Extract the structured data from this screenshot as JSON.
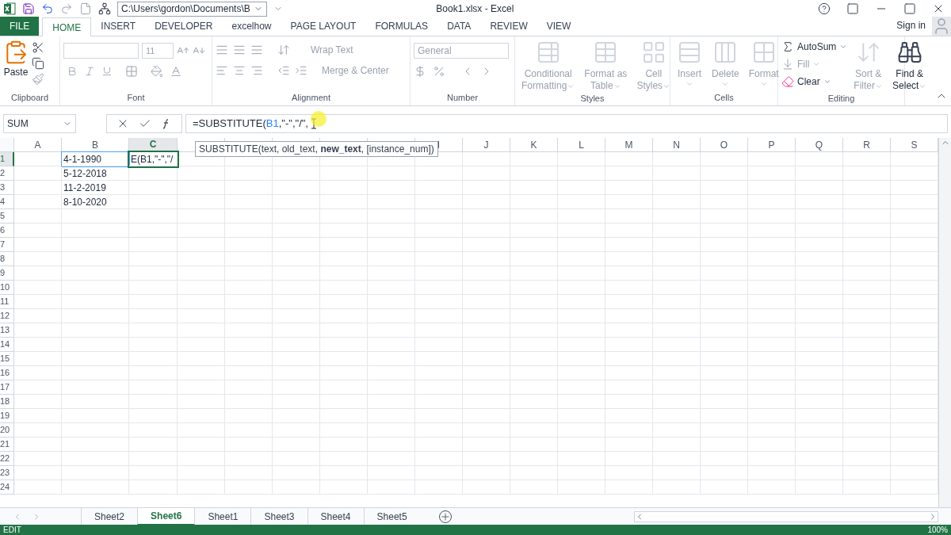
{
  "title_bar": {
    "path": "C:\\Users\\gordon\\Documents\\B",
    "title": "Book1.xlsx - Excel"
  },
  "ribbon_tabs": [
    {
      "label": "FILE",
      "kind": "file",
      "selected": false
    },
    {
      "label": "HOME",
      "kind": "tab",
      "selected": true
    },
    {
      "label": "INSERT",
      "kind": "tab",
      "selected": false
    },
    {
      "label": "DEVELOPER",
      "kind": "tab",
      "selected": false
    },
    {
      "label": "excelhow",
      "kind": "tab",
      "selected": false
    },
    {
      "label": "PAGE LAYOUT",
      "kind": "tab",
      "selected": false
    },
    {
      "label": "FORMULAS",
      "kind": "tab",
      "selected": false
    },
    {
      "label": "DATA",
      "kind": "tab",
      "selected": false
    },
    {
      "label": "REVIEW",
      "kind": "tab",
      "selected": false
    },
    {
      "label": "VIEW",
      "kind": "tab",
      "selected": false
    }
  ],
  "sign_in": "Sign in",
  "clipboard": {
    "label": "Clipboard",
    "paste": "Paste"
  },
  "font": {
    "label": "Font",
    "size": "11"
  },
  "alignment": {
    "label": "Alignment",
    "wrap": "Wrap Text",
    "merge": "Merge & Center"
  },
  "number": {
    "label": "Number",
    "format": "General"
  },
  "styles": {
    "label": "Styles",
    "buttons": [
      {
        "label": "Conditional",
        "label2": "Formatting",
        "disabled": true
      },
      {
        "label": "Format as",
        "label2": "Table",
        "disabled": true
      },
      {
        "label": "Cell",
        "label2": "Styles",
        "disabled": true
      }
    ]
  },
  "cells": {
    "label": "Cells",
    "buttons": [
      {
        "label": "Insert",
        "disabled": true
      },
      {
        "label": "Delete",
        "disabled": true
      },
      {
        "label": "Format",
        "disabled": true
      }
    ]
  },
  "editing": {
    "label": "Editing",
    "autosum": "AutoSum",
    "fill": "Fill",
    "clear": "Clear",
    "sort": {
      "label": "Sort &",
      "label2": "Filter",
      "disabled": true
    },
    "find": {
      "label": "Find &",
      "label2": "Select",
      "disabled": false
    }
  },
  "formula_bar": {
    "name_box": "SUM",
    "start": "=SUBSTITUTE(",
    "ref": "B1",
    "rest": ",\"-\",\"/\","
  },
  "tooltip": "SUBSTITUTE(text, old_text, **new_text**, [instance_num])",
  "columns": [
    {
      "label": "A",
      "selected": false
    },
    {
      "label": "B",
      "selected": false
    },
    {
      "label": "C",
      "selected": true
    },
    {
      "selected": false
    },
    {
      "selected": false
    },
    {
      "selected": false
    },
    {
      "selected": false
    },
    {
      "selected": false
    },
    {
      "label": "I",
      "selected": false
    },
    {
      "label": "J",
      "selected": false
    },
    {
      "label": "K",
      "selected": false
    },
    {
      "label": "L",
      "selected": false
    },
    {
      "label": "M",
      "selected": false
    },
    {
      "label": "N",
      "selected": false
    },
    {
      "label": "O",
      "selected": false
    },
    {
      "label": "P",
      "selected": false
    },
    {
      "label": "Q",
      "selected": false
    },
    {
      "label": "R",
      "selected": false
    },
    {
      "label": "S",
      "selected": false
    }
  ],
  "rows": [
    {
      "label": "1",
      "selected": true,
      "cells": [
        "",
        "4-1-1990",
        "E(B1,\"-\",\"/"
      ]
    },
    {
      "label": "2",
      "selected": false,
      "cells": [
        "",
        "5-12-2018",
        ""
      ]
    },
    {
      "label": "3",
      "selected": false,
      "cells": [
        "",
        "11-2-2019",
        ""
      ]
    },
    {
      "label": "4",
      "selected": false,
      "cells": [
        "",
        "8-10-2020",
        ""
      ]
    },
    {
      "label": "5",
      "selected": false,
      "cells": []
    },
    {
      "label": "6",
      "selected": false,
      "cells": []
    },
    {
      "label": "7",
      "selected": false,
      "cells": []
    },
    {
      "label": "8",
      "selected": false,
      "cells": []
    },
    {
      "label": "9",
      "selected": false,
      "cells": []
    },
    {
      "label": "10",
      "selected": false,
      "cells": []
    },
    {
      "label": "11",
      "selected": false,
      "cells": []
    },
    {
      "label": "12",
      "selected": false,
      "cells": []
    },
    {
      "label": "13",
      "selected": false,
      "cells": []
    },
    {
      "label": "14",
      "selected": false,
      "cells": []
    },
    {
      "label": "15",
      "selected": false,
      "cells": []
    },
    {
      "label": "16",
      "selected": false,
      "cells": []
    },
    {
      "label": "17",
      "selected": false,
      "cells": []
    },
    {
      "label": "18",
      "selected": false,
      "cells": []
    },
    {
      "label": "19",
      "selected": false,
      "cells": []
    },
    {
      "label": "20",
      "selected": false,
      "cells": []
    },
    {
      "label": "21",
      "selected": false,
      "cells": []
    },
    {
      "label": "22",
      "selected": false,
      "cells": []
    },
    {
      "label": "23",
      "selected": false,
      "cells": []
    },
    {
      "label": "24",
      "selected": false,
      "cells": []
    }
  ],
  "sheet_tabs": [
    {
      "label": "Sheet2",
      "selected": false
    },
    {
      "label": "Sheet6",
      "selected": true
    },
    {
      "label": "Sheet1",
      "selected": false
    },
    {
      "label": "Sheet3",
      "selected": false
    },
    {
      "label": "Sheet4",
      "selected": false
    },
    {
      "label": "Sheet5",
      "selected": false
    }
  ],
  "status_bar": {
    "mode": "EDIT",
    "zoom": "100%"
  }
}
